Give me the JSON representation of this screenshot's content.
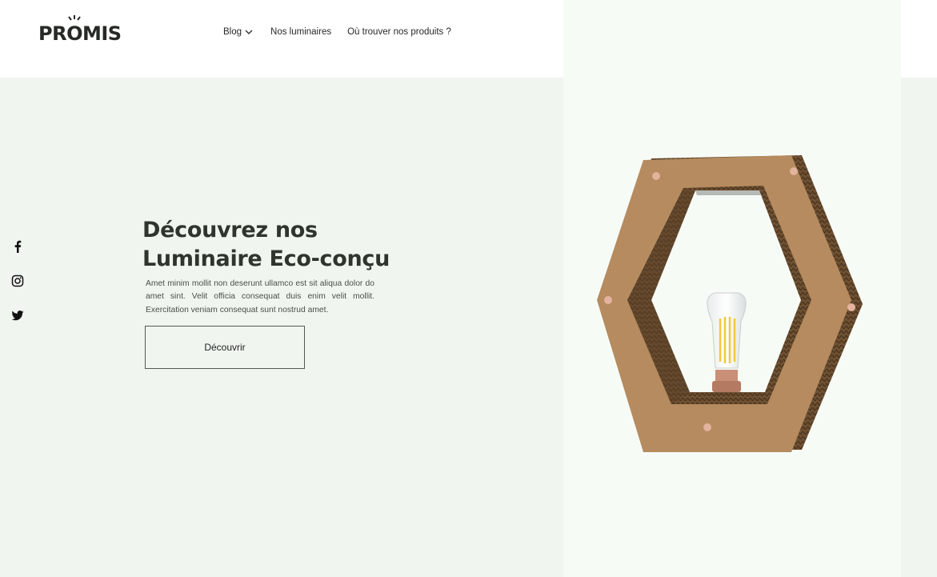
{
  "header": {
    "logo_text": "PROMIS",
    "logo_left": "PR",
    "logo_o": "O",
    "logo_right": "MIS",
    "nav": {
      "blog": "Blog",
      "luminaires": "Nos luminaires",
      "where": "Où trouver nos produits ?"
    }
  },
  "hero": {
    "title_line1": "Découvrez nos",
    "title_line2": "Luminaire Eco-conçu",
    "text": "Amet minim mollit non deserunt ullamco est sit aliqua dolor do amet sint. Velit officia consequat duis enim velit mollit. Exercitation veniam consequat sunt nostrud amet.",
    "cta_label": "Découvrir"
  },
  "social": {
    "icons": [
      "facebook-icon",
      "instagram-icon",
      "twitter-icon"
    ]
  },
  "colors": {
    "page_bg": "#f1f5ef",
    "panel_bg": "#f7fbf6",
    "header_bg": "#ffffff",
    "text_dark": "#2f352d",
    "cardboard": "#b58b5f"
  }
}
